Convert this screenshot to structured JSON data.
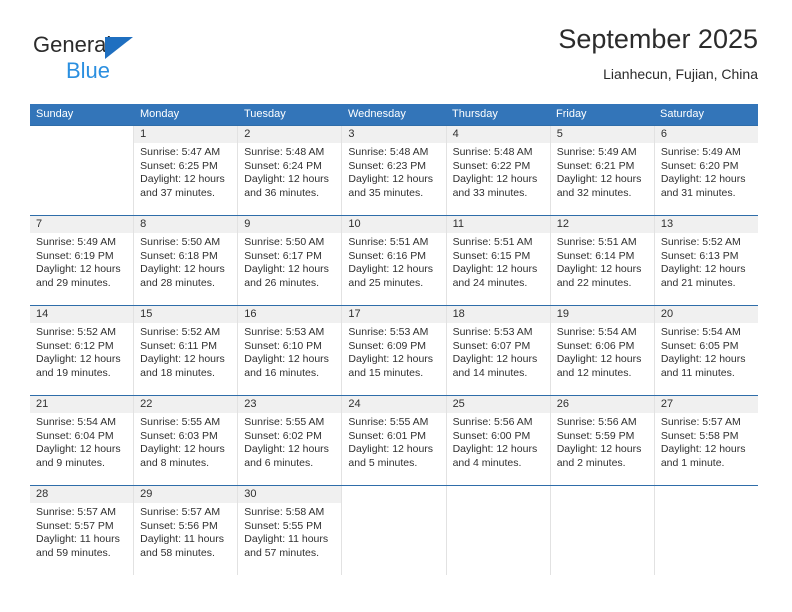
{
  "brand": {
    "word_general": "General",
    "word_blue": "Blue",
    "triangle_color": "#1f6fc0",
    "blue_color": "#2b8fe0"
  },
  "header": {
    "title": "September 2025",
    "subtitle": "Lianhecun, Fujian, China",
    "accent_color": "#3375b9"
  },
  "calendar": {
    "weekdays": [
      "Sunday",
      "Monday",
      "Tuesday",
      "Wednesday",
      "Thursday",
      "Friday",
      "Saturday"
    ],
    "weeks": [
      [
        {
          "day": "",
          "sunrise": "",
          "sunset": "",
          "daylight1": "",
          "daylight2": ""
        },
        {
          "day": "1",
          "sunrise": "Sunrise: 5:47 AM",
          "sunset": "Sunset: 6:25 PM",
          "daylight1": "Daylight: 12 hours",
          "daylight2": "and 37 minutes."
        },
        {
          "day": "2",
          "sunrise": "Sunrise: 5:48 AM",
          "sunset": "Sunset: 6:24 PM",
          "daylight1": "Daylight: 12 hours",
          "daylight2": "and 36 minutes."
        },
        {
          "day": "3",
          "sunrise": "Sunrise: 5:48 AM",
          "sunset": "Sunset: 6:23 PM",
          "daylight1": "Daylight: 12 hours",
          "daylight2": "and 35 minutes."
        },
        {
          "day": "4",
          "sunrise": "Sunrise: 5:48 AM",
          "sunset": "Sunset: 6:22 PM",
          "daylight1": "Daylight: 12 hours",
          "daylight2": "and 33 minutes."
        },
        {
          "day": "5",
          "sunrise": "Sunrise: 5:49 AM",
          "sunset": "Sunset: 6:21 PM",
          "daylight1": "Daylight: 12 hours",
          "daylight2": "and 32 minutes."
        },
        {
          "day": "6",
          "sunrise": "Sunrise: 5:49 AM",
          "sunset": "Sunset: 6:20 PM",
          "daylight1": "Daylight: 12 hours",
          "daylight2": "and 31 minutes."
        }
      ],
      [
        {
          "day": "7",
          "sunrise": "Sunrise: 5:49 AM",
          "sunset": "Sunset: 6:19 PM",
          "daylight1": "Daylight: 12 hours",
          "daylight2": "and 29 minutes."
        },
        {
          "day": "8",
          "sunrise": "Sunrise: 5:50 AM",
          "sunset": "Sunset: 6:18 PM",
          "daylight1": "Daylight: 12 hours",
          "daylight2": "and 28 minutes."
        },
        {
          "day": "9",
          "sunrise": "Sunrise: 5:50 AM",
          "sunset": "Sunset: 6:17 PM",
          "daylight1": "Daylight: 12 hours",
          "daylight2": "and 26 minutes."
        },
        {
          "day": "10",
          "sunrise": "Sunrise: 5:51 AM",
          "sunset": "Sunset: 6:16 PM",
          "daylight1": "Daylight: 12 hours",
          "daylight2": "and 25 minutes."
        },
        {
          "day": "11",
          "sunrise": "Sunrise: 5:51 AM",
          "sunset": "Sunset: 6:15 PM",
          "daylight1": "Daylight: 12 hours",
          "daylight2": "and 24 minutes."
        },
        {
          "day": "12",
          "sunrise": "Sunrise: 5:51 AM",
          "sunset": "Sunset: 6:14 PM",
          "daylight1": "Daylight: 12 hours",
          "daylight2": "and 22 minutes."
        },
        {
          "day": "13",
          "sunrise": "Sunrise: 5:52 AM",
          "sunset": "Sunset: 6:13 PM",
          "daylight1": "Daylight: 12 hours",
          "daylight2": "and 21 minutes."
        }
      ],
      [
        {
          "day": "14",
          "sunrise": "Sunrise: 5:52 AM",
          "sunset": "Sunset: 6:12 PM",
          "daylight1": "Daylight: 12 hours",
          "daylight2": "and 19 minutes."
        },
        {
          "day": "15",
          "sunrise": "Sunrise: 5:52 AM",
          "sunset": "Sunset: 6:11 PM",
          "daylight1": "Daylight: 12 hours",
          "daylight2": "and 18 minutes."
        },
        {
          "day": "16",
          "sunrise": "Sunrise: 5:53 AM",
          "sunset": "Sunset: 6:10 PM",
          "daylight1": "Daylight: 12 hours",
          "daylight2": "and 16 minutes."
        },
        {
          "day": "17",
          "sunrise": "Sunrise: 5:53 AM",
          "sunset": "Sunset: 6:09 PM",
          "daylight1": "Daylight: 12 hours",
          "daylight2": "and 15 minutes."
        },
        {
          "day": "18",
          "sunrise": "Sunrise: 5:53 AM",
          "sunset": "Sunset: 6:07 PM",
          "daylight1": "Daylight: 12 hours",
          "daylight2": "and 14 minutes."
        },
        {
          "day": "19",
          "sunrise": "Sunrise: 5:54 AM",
          "sunset": "Sunset: 6:06 PM",
          "daylight1": "Daylight: 12 hours",
          "daylight2": "and 12 minutes."
        },
        {
          "day": "20",
          "sunrise": "Sunrise: 5:54 AM",
          "sunset": "Sunset: 6:05 PM",
          "daylight1": "Daylight: 12 hours",
          "daylight2": "and 11 minutes."
        }
      ],
      [
        {
          "day": "21",
          "sunrise": "Sunrise: 5:54 AM",
          "sunset": "Sunset: 6:04 PM",
          "daylight1": "Daylight: 12 hours",
          "daylight2": "and 9 minutes."
        },
        {
          "day": "22",
          "sunrise": "Sunrise: 5:55 AM",
          "sunset": "Sunset: 6:03 PM",
          "daylight1": "Daylight: 12 hours",
          "daylight2": "and 8 minutes."
        },
        {
          "day": "23",
          "sunrise": "Sunrise: 5:55 AM",
          "sunset": "Sunset: 6:02 PM",
          "daylight1": "Daylight: 12 hours",
          "daylight2": "and 6 minutes."
        },
        {
          "day": "24",
          "sunrise": "Sunrise: 5:55 AM",
          "sunset": "Sunset: 6:01 PM",
          "daylight1": "Daylight: 12 hours",
          "daylight2": "and 5 minutes."
        },
        {
          "day": "25",
          "sunrise": "Sunrise: 5:56 AM",
          "sunset": "Sunset: 6:00 PM",
          "daylight1": "Daylight: 12 hours",
          "daylight2": "and 4 minutes."
        },
        {
          "day": "26",
          "sunrise": "Sunrise: 5:56 AM",
          "sunset": "Sunset: 5:59 PM",
          "daylight1": "Daylight: 12 hours",
          "daylight2": "and 2 minutes."
        },
        {
          "day": "27",
          "sunrise": "Sunrise: 5:57 AM",
          "sunset": "Sunset: 5:58 PM",
          "daylight1": "Daylight: 12 hours",
          "daylight2": "and 1 minute."
        }
      ],
      [
        {
          "day": "28",
          "sunrise": "Sunrise: 5:57 AM",
          "sunset": "Sunset: 5:57 PM",
          "daylight1": "Daylight: 11 hours",
          "daylight2": "and 59 minutes."
        },
        {
          "day": "29",
          "sunrise": "Sunrise: 5:57 AM",
          "sunset": "Sunset: 5:56 PM",
          "daylight1": "Daylight: 11 hours",
          "daylight2": "and 58 minutes."
        },
        {
          "day": "30",
          "sunrise": "Sunrise: 5:58 AM",
          "sunset": "Sunset: 5:55 PM",
          "daylight1": "Daylight: 11 hours",
          "daylight2": "and 57 minutes."
        },
        {
          "day": "",
          "sunrise": "",
          "sunset": "",
          "daylight1": "",
          "daylight2": ""
        },
        {
          "day": "",
          "sunrise": "",
          "sunset": "",
          "daylight1": "",
          "daylight2": ""
        },
        {
          "day": "",
          "sunrise": "",
          "sunset": "",
          "daylight1": "",
          "daylight2": ""
        },
        {
          "day": "",
          "sunrise": "",
          "sunset": "",
          "daylight1": "",
          "daylight2": ""
        }
      ]
    ]
  }
}
